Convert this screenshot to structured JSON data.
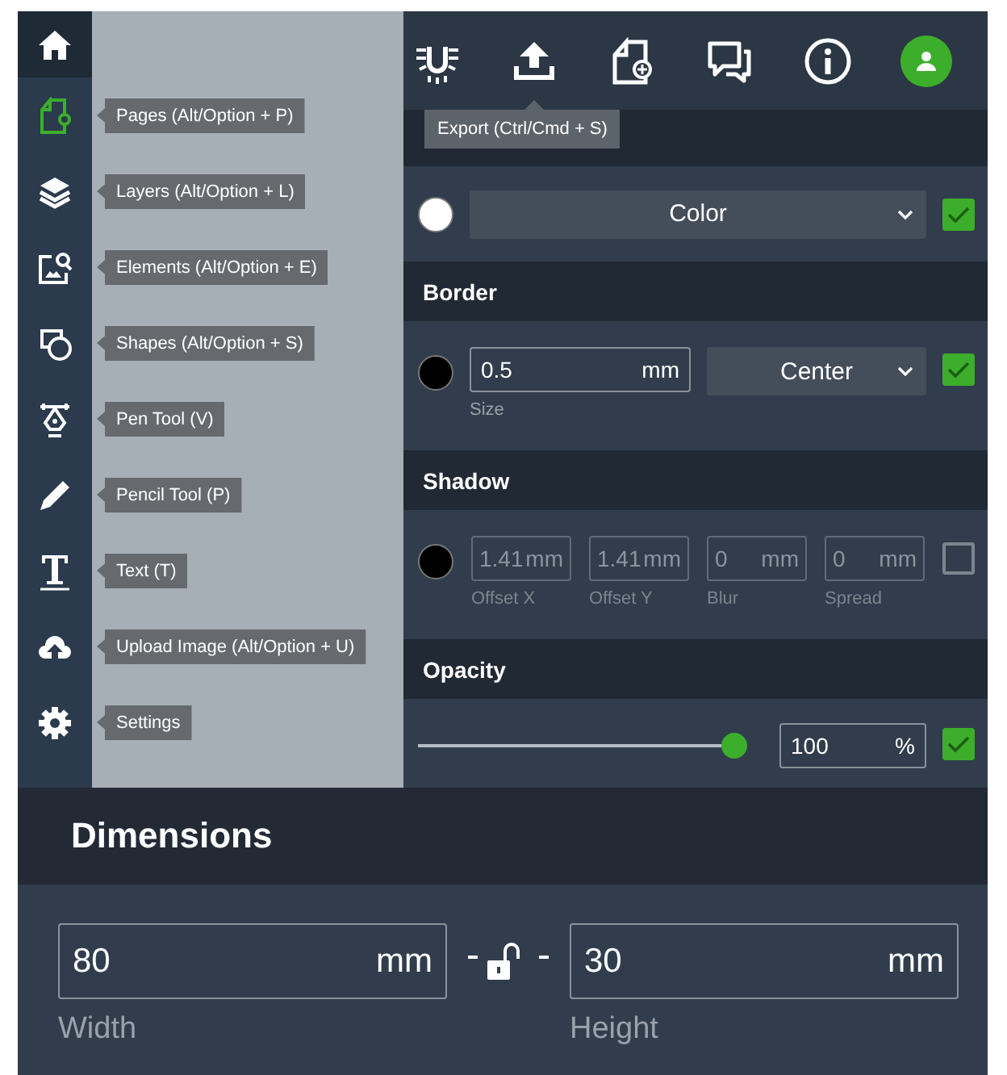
{
  "sidebar": {
    "items": [
      {
        "kind": "pages",
        "tooltip": "Pages (Alt/Option + P)",
        "selected": true
      },
      {
        "kind": "layers",
        "tooltip": "Layers (Alt/Option + L)",
        "selected": false
      },
      {
        "kind": "elements",
        "tooltip": "Elements (Alt/Option + E)",
        "selected": false
      },
      {
        "kind": "shapes",
        "tooltip": "Shapes (Alt/Option + S)",
        "selected": false
      },
      {
        "kind": "pen",
        "tooltip": "Pen Tool (V)",
        "selected": false
      },
      {
        "kind": "pencil",
        "tooltip": "Pencil Tool (P)",
        "selected": false
      },
      {
        "kind": "text",
        "tooltip": "Text (T)",
        "selected": false
      },
      {
        "kind": "upload",
        "tooltip": "Upload Image (Alt/Option + U)",
        "selected": false
      },
      {
        "kind": "settings",
        "tooltip": "Settings",
        "selected": false
      }
    ]
  },
  "toolbar": {
    "icons": [
      {
        "kind": "magnet"
      },
      {
        "kind": "export"
      },
      {
        "kind": "add-page"
      },
      {
        "kind": "chat"
      },
      {
        "kind": "info"
      }
    ],
    "tooltip": "Export (Ctrl/Cmd + S)"
  },
  "fill": {
    "color": "#ffffff",
    "dropdown": "Color",
    "checked": true
  },
  "border": {
    "title": "Border",
    "color": "#000000",
    "size": {
      "value": "0.5",
      "unit": "mm",
      "label": "Size"
    },
    "dropdown": "Center",
    "checked": true
  },
  "shadow": {
    "title": "Shadow",
    "color": "#000000",
    "disabled": true,
    "checked": false,
    "fields": [
      {
        "value": "1.41",
        "unit": "mm",
        "label": "Offset X"
      },
      {
        "value": "1.41",
        "unit": "mm",
        "label": "Offset Y"
      },
      {
        "value": "0",
        "unit": "mm",
        "label": "Blur"
      },
      {
        "value": "0",
        "unit": "mm",
        "label": "Spread"
      }
    ]
  },
  "opacity": {
    "title": "Opacity",
    "level": 1,
    "value": "100",
    "unit": "%",
    "checked": true
  },
  "dimensions": {
    "title": "Dimensions",
    "locked": false,
    "width": {
      "value": "80",
      "unit": "mm",
      "label": "Width"
    },
    "height": {
      "value": "30",
      "unit": "mm",
      "label": "Height"
    }
  }
}
